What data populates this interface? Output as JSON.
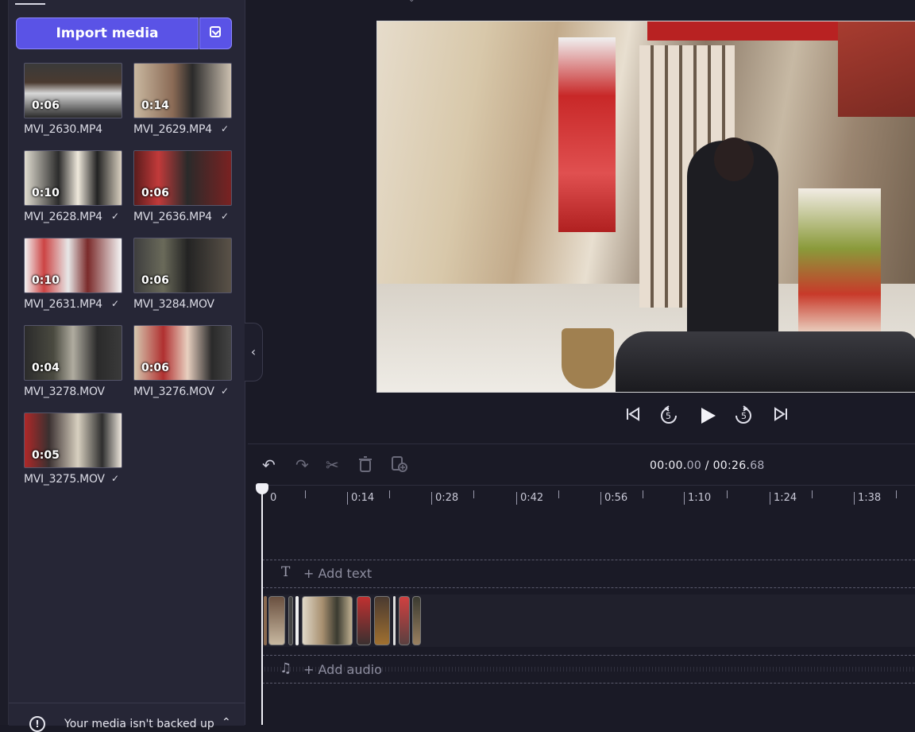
{
  "media_panel": {
    "import_button": "Import media",
    "items": [
      {
        "name": "MVI_2630.MP4",
        "duration": "0:06",
        "used": false
      },
      {
        "name": "MVI_2629.MP4",
        "duration": "0:14",
        "used": true
      },
      {
        "name": "MVI_2628.MP4",
        "duration": "0:10",
        "used": true
      },
      {
        "name": "MVI_2636.MP4",
        "duration": "0:06",
        "used": true
      },
      {
        "name": "MVI_2631.MP4",
        "duration": "0:10",
        "used": true
      },
      {
        "name": "MVI_3284.MOV",
        "duration": "0:06",
        "used": false
      },
      {
        "name": "MVI_3278.MOV",
        "duration": "0:04",
        "used": false
      },
      {
        "name": "MVI_3276.MOV",
        "duration": "0:06",
        "used": true
      },
      {
        "name": "MVI_3275.MOV",
        "duration": "0:05",
        "used": true
      }
    ],
    "check_glyph": "✓",
    "backup_message": "Your media isn't backed up"
  },
  "playback": {
    "skip_start_icon": "skip-to-start-icon",
    "rewind_label": "5",
    "forward_label": "5",
    "skip_end_icon": "skip-to-end-icon"
  },
  "timeline": {
    "current_time_main": "00:00.",
    "current_time_ms": "00",
    "separator": "/",
    "total_time_main": "00:26.",
    "total_time_ms": "68",
    "ruler_labels": [
      "0",
      "0:14",
      "0:28",
      "0:42",
      "0:56",
      "1:10",
      "1:24",
      "1:38"
    ],
    "add_text": "+ Add text",
    "add_audio": "+ Add audio"
  },
  "colors": {
    "accent": "#5a53e6",
    "panel_bg": "#262636",
    "app_bg": "#1a1a26"
  }
}
